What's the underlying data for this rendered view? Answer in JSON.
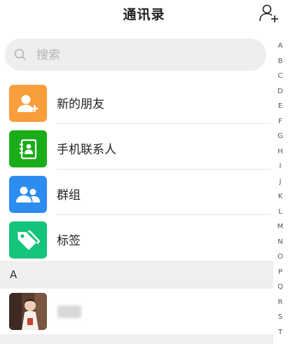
{
  "header": {
    "title": "通讯录"
  },
  "search": {
    "placeholder": "搜索"
  },
  "functions": [
    {
      "label": "新的朋友",
      "icon": "new-friend-icon",
      "color": "#FA9D3B"
    },
    {
      "label": "手机联系人",
      "icon": "phone-contacts-icon",
      "color": "#1AAD19"
    },
    {
      "label": "群组",
      "icon": "group-icon",
      "color": "#2D8CF0"
    },
    {
      "label": "标签",
      "icon": "tag-icon",
      "color": "#14C47A"
    }
  ],
  "sections": [
    {
      "letter": "A",
      "contacts": [
        {
          "avatar": "avatar-photo"
        }
      ]
    }
  ],
  "index": [
    "A",
    "B",
    "C",
    "D",
    "E",
    "F",
    "G",
    "H",
    "I",
    "J",
    "K",
    "L",
    "M",
    "N",
    "O",
    "P",
    "Q",
    "R",
    "S",
    "T"
  ]
}
